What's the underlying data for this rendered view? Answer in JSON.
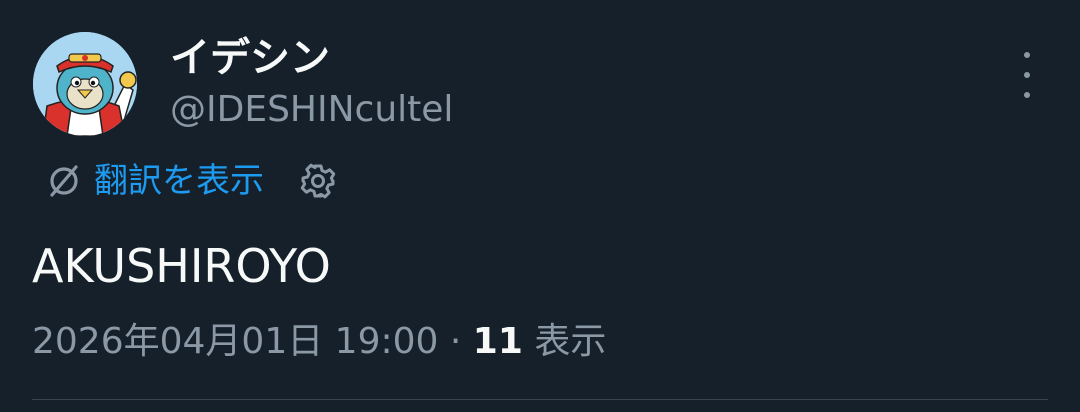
{
  "post": {
    "author": {
      "display_name": "イデシン",
      "handle": "@IDESHINcultel",
      "avatar_icon": "penguin-mascot-avatar"
    },
    "more_icon": "more-vertical-icon",
    "translate": {
      "icon": "translate-icon",
      "label": "翻訳を表示",
      "settings_icon": "gear-icon"
    },
    "text": "AKUSHIROYO",
    "timestamp": "2026年04月01日 19:00",
    "separator": "·",
    "views_count": "11",
    "views_label": "表示",
    "colors": {
      "background": "#15202b",
      "text": "#f7f9f9",
      "secondary": "#8b98a5",
      "accent": "#1d9bf0",
      "divider": "#38444d"
    }
  }
}
